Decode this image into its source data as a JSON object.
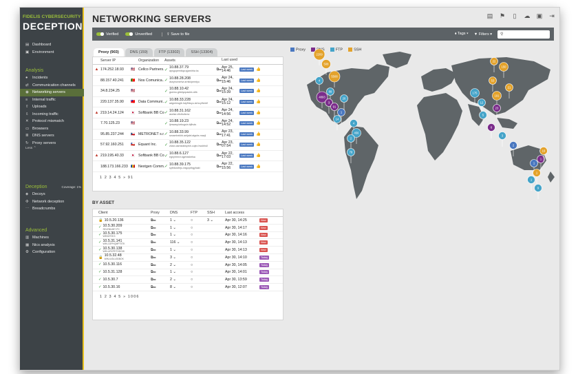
{
  "brand": {
    "line1": "FIDELIS CYBERSECURITY",
    "line2": "DECEPTION"
  },
  "nav": {
    "top": [
      {
        "icon": "dashboard-icon",
        "glyph": "▤",
        "label": "Dashboard"
      },
      {
        "icon": "environment-icon",
        "glyph": "▣",
        "label": "Environment"
      }
    ],
    "analysis_title": "Analysis",
    "analysis": [
      {
        "icon": "alert-icon",
        "glyph": "●",
        "label": "Incidents"
      },
      {
        "icon": "channels-icon",
        "glyph": "⇄",
        "label": "Communication channels"
      },
      {
        "icon": "globe-icon",
        "glyph": "◉",
        "label": "Networking servers"
      },
      {
        "icon": "traffic-icon",
        "glyph": "≡",
        "label": "Internal traffic"
      },
      {
        "icon": "upload-icon",
        "glyph": "⇧",
        "label": "Uploads"
      },
      {
        "icon": "incoming-icon",
        "glyph": "⇩",
        "label": "Incoming traffic"
      },
      {
        "icon": "mismatch-icon",
        "glyph": "✕",
        "label": "Protocol mismatch"
      },
      {
        "icon": "browser-icon",
        "glyph": "▭",
        "label": "Browsers"
      },
      {
        "icon": "dns-icon",
        "glyph": "≣",
        "label": "DNS servers"
      },
      {
        "icon": "proxy-icon",
        "glyph": "↻",
        "label": "Proxy servers"
      }
    ],
    "less": "Less ⌃",
    "deception_title": "Deception",
    "coverage": "Coverage: 1%",
    "deception": [
      {
        "icon": "decoy-icon",
        "glyph": "◈",
        "label": "Decoys"
      },
      {
        "icon": "network-icon",
        "glyph": "✣",
        "label": "Network deception"
      },
      {
        "icon": "breadcrumb-icon",
        "glyph": "⋯",
        "label": "Breadcrumbs"
      }
    ],
    "advanced_title": "Advanced",
    "advanced": [
      {
        "icon": "machine-icon",
        "glyph": "▥",
        "label": "Machines"
      },
      {
        "icon": "nics-icon",
        "glyph": "▦",
        "label": "Nics analysis"
      },
      {
        "icon": "config-icon",
        "glyph": "⚙",
        "label": "Configuration"
      }
    ]
  },
  "page": {
    "title": "NETWORKING SERVERS"
  },
  "filterbar": {
    "verified": "Verified",
    "unverified": "Unverified",
    "save": "Save to file",
    "tags": "Tags ▾",
    "filters": "Filters ▾",
    "search_placeholder": ""
  },
  "tabs": [
    "Proxy (903)",
    "DNS (159)",
    "FTP (13302)",
    "SSH (13304)"
  ],
  "servers": {
    "headers": [
      "Server IP",
      "Organization",
      "Assets",
      "Last used"
    ],
    "rows": [
      {
        "warn": "▲",
        "ip": "174.252.18.93",
        "flag": "🇺🇸",
        "org": "Cellco Partners...",
        "asset": "10.88.37.79",
        "sub": "apsgupemitqa.iyjamirha ks",
        "last": "Apr 25, 14:46"
      },
      {
        "warn": "",
        "ip": "88.157.40.241",
        "flag": "🇵🇹",
        "org": "Nos Comunica...",
        "asset": "10.88.28.208",
        "sub": "dseyhomehvr.arhitcipemtyu",
        "last": "Apr 24, 15:46"
      },
      {
        "warn": "",
        "ip": "34.8.234.25",
        "flag": "🇺🇸",
        "org": "",
        "asset": "10.88.10.42",
        "sub": "gsemu.glrsbyupasles afrk",
        "last": "Apr 24, 15:39"
      },
      {
        "warn": "",
        "ip": "220.137.35.90",
        "flag": "🇹🇼",
        "org": "Data Communi...",
        "asset": "10.88.33.228",
        "sub": "adgmhrsgib.hdyfhlwyu.ial kcyfheldf",
        "last": "Apr 24, 15:12"
      },
      {
        "warn": "▲",
        "ip": "219.14.24.124",
        "flag": "🇯🇵",
        "org": "Softbank BB Co...",
        "asset": "10.88.31.162",
        "sub": "aselse.cftclbufsmv",
        "last": "Apr 24, 14:56"
      },
      {
        "warn": "",
        "ip": "7.70.125.23",
        "flag": "🇺🇸",
        "org": "",
        "asset": "10.88.19.23",
        "sub": "ljmwasy.kekugsin.bjfhuls",
        "last": "Apr 24, 14:52"
      },
      {
        "warn": "",
        "ip": "95.85.237.244",
        "flag": "🇨🇿",
        "org": "METRONET s.r.o.",
        "asset": "10.88.33.99",
        "sub": "secsmhekhb.aeljalel.algshs mazjl",
        "last": "Apr 23, 17:41"
      },
      {
        "warn": "",
        "ip": "57.92.160.251",
        "flag": "🇨🇱",
        "org": "Equant Inc.",
        "asset": "10.88.35.122",
        "sub": "zkzsv.asmstabsyrkh.cujeo bvubhsll",
        "last": "Apr 23, 07:54"
      },
      {
        "warn": "▲",
        "ip": "219.195.40.33",
        "flag": "🇯🇵",
        "org": "Softbank BB Co...",
        "asset": "10.88.6.127",
        "sub": "egnyhrmvr.iqymdsbelsa",
        "last": "Apr 22, 17:03"
      },
      {
        "warn": "",
        "ip": "188.173.166.233",
        "flag": "🇷🇴",
        "org": "Nextgen Comm...",
        "asset": "10.88.39.175",
        "sub": "spfekcwfrrju.edgoyebgyhakt",
        "last": "Apr 22, 15:56"
      }
    ],
    "badge": "Last week",
    "pager": "1 2 3 4 5 » 91"
  },
  "byasset": {
    "title": "BY ASSET",
    "headers": [
      "Client",
      "Proxy",
      "DNS",
      "FTP",
      "SSH",
      "Last access"
    ],
    "rows": [
      {
        "lock": true,
        "client": "10.5.20.136",
        "sub": "",
        "dns": "1",
        "ssh": "3",
        "last": "Apr 30, 14:25",
        "status": "New"
      },
      {
        "lock": false,
        "client": "10.5.30.209",
        "sub": "SELENIUM7-PC",
        "dns": "1",
        "ssh": "",
        "last": "Apr 30, 14:17",
        "status": "New"
      },
      {
        "lock": false,
        "client": "10.5.30.175",
        "sub": "WIN32T2K3",
        "dns": "1",
        "ssh": "",
        "last": "Apr 30, 14:16",
        "status": "New"
      },
      {
        "lock": false,
        "client": "10.5.31.141",
        "sub": "WIN-O2PHQMPT5TK",
        "dns": "116",
        "ssh": "",
        "last": "Apr 30, 14:13",
        "status": "New"
      },
      {
        "lock": false,
        "client": "10.5.30.138",
        "sub": "WIN-URCPETHDGHI",
        "dns": "1",
        "ssh": "",
        "last": "Apr 30, 14:13",
        "status": "New"
      },
      {
        "lock": true,
        "client": "10.5.32.48",
        "sub": "WIN-6J0LU0DBOK",
        "dns": "3",
        "ssh": "",
        "last": "Apr 30, 14:10",
        "status": "Today"
      },
      {
        "lock": false,
        "client": "10.5.30.116",
        "sub": "",
        "dns": "2",
        "ssh": "",
        "last": "Apr 30, 14:05",
        "status": "Today"
      },
      {
        "lock": false,
        "client": "10.5.31.128",
        "sub": "",
        "dns": "1",
        "ssh": "",
        "last": "Apr 30, 14:01",
        "status": "Today"
      },
      {
        "lock": false,
        "client": "10.5.30.7",
        "sub": "",
        "dns": "2",
        "ssh": "",
        "last": "Apr 30, 13:59",
        "status": "Today"
      },
      {
        "lock": false,
        "client": "10.5.30.16",
        "sub": "",
        "dns": "8",
        "ssh": "",
        "last": "Apr 30, 12:07",
        "status": "Today"
      }
    ],
    "pager": "1 2 3 4 5 » 1006"
  },
  "legend": [
    {
      "label": "Proxy",
      "color": "#4a78c0"
    },
    {
      "label": "DNS",
      "color": "#7b2d8b"
    },
    {
      "label": "FTP",
      "color": "#45a4c9"
    },
    {
      "label": "SSH",
      "color": "#e3a22b"
    }
  ],
  "map": {
    "markers": [
      {
        "v": "2209",
        "c": "#e3a22b"
      },
      {
        "v": "508",
        "c": "#e3a22b"
      },
      {
        "v": "5508",
        "c": "#e3a22b"
      },
      {
        "v": "4",
        "c": "#45a4c9"
      },
      {
        "v": "89",
        "c": "#45a4c9"
      },
      {
        "v": "4893",
        "c": "#7b2d8b"
      },
      {
        "v": "3",
        "c": "#7b2d8b"
      },
      {
        "v": "91",
        "c": "#7b2d8b"
      },
      {
        "v": "1",
        "c": "#4a78c0"
      },
      {
        "v": "20",
        "c": "#45a4c9"
      },
      {
        "v": "14",
        "c": "#45a4c9"
      },
      {
        "v": "4",
        "c": "#45a4c9"
      },
      {
        "v": "456",
        "c": "#45a4c9"
      },
      {
        "v": "2",
        "c": "#45a4c9"
      },
      {
        "v": "78",
        "c": "#45a4c9"
      },
      {
        "v": "22",
        "c": "#e3a22b"
      },
      {
        "v": "53",
        "c": "#e3a22b"
      },
      {
        "v": "191",
        "c": "#e3a22b"
      },
      {
        "v": "23",
        "c": "#7b2d8b"
      },
      {
        "v": "150",
        "c": "#e3a22b"
      },
      {
        "v": "21",
        "c": "#e3a22b"
      },
      {
        "v": "175",
        "c": "#45a4c9"
      },
      {
        "v": "12",
        "c": "#45a4c9"
      },
      {
        "v": "5",
        "c": "#45a4c9"
      },
      {
        "v": "6",
        "c": "#7b2d8b"
      },
      {
        "v": "3",
        "c": "#45a4c9"
      },
      {
        "v": "2",
        "c": "#4a78c0"
      },
      {
        "v": "1",
        "c": "#4a78c0"
      },
      {
        "v": "1",
        "c": "#e3a22b"
      },
      {
        "v": "1",
        "c": "#45a4c9"
      },
      {
        "v": "9",
        "c": "#45a4c9"
      },
      {
        "v": "1",
        "c": "#7b2d8b"
      },
      {
        "v": "19",
        "c": "#e3a22b"
      }
    ]
  }
}
